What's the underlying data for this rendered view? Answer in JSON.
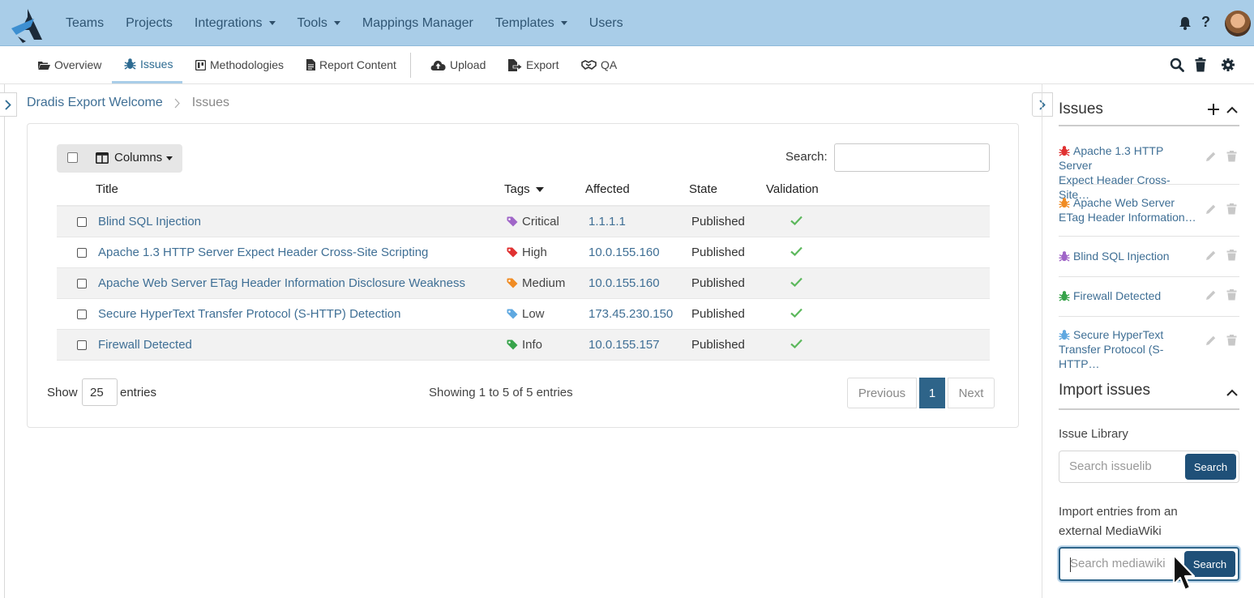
{
  "topnav": {
    "items": [
      {
        "label": "Teams",
        "dropdown": false
      },
      {
        "label": "Projects",
        "dropdown": false
      },
      {
        "label": "Integrations",
        "dropdown": true
      },
      {
        "label": "Tools",
        "dropdown": true
      },
      {
        "label": "Mappings Manager",
        "dropdown": false
      },
      {
        "label": "Templates",
        "dropdown": true
      },
      {
        "label": "Users",
        "dropdown": false
      }
    ],
    "help": "?"
  },
  "subnav": {
    "overview": "Overview",
    "issues": "Issues",
    "methodologies": "Methodologies",
    "report_content": "Report Content",
    "upload": "Upload",
    "export": "Export",
    "qa": "QA"
  },
  "breadcrumb": {
    "project": "Dradis Export Welcome",
    "current": "Issues"
  },
  "table": {
    "columns_button": "Columns",
    "search_label": "Search:",
    "headers": {
      "title": "Title",
      "tags": "Tags",
      "affected": "Affected",
      "state": "State",
      "validation": "Validation"
    },
    "rows": [
      {
        "title": "Blind SQL Injection",
        "tag": "Critical",
        "tag_color": "#a066c8",
        "affected": "1.1.1.1",
        "state": "Published"
      },
      {
        "title": "Apache 1.3 HTTP Server Expect Header Cross-Site Scripting",
        "tag": "High",
        "tag_color": "#e03131",
        "affected": "10.0.155.160",
        "state": "Published"
      },
      {
        "title": "Apache Web Server ETag Header Information Disclosure Weakness",
        "tag": "Medium",
        "tag_color": "#f08c24",
        "affected": "10.0.155.160",
        "state": "Published"
      },
      {
        "title": "Secure HyperText Transfer Protocol (S-HTTP) Detection",
        "tag": "Low",
        "tag_color": "#5fa8e0",
        "affected": "173.45.230.150",
        "state": "Published"
      },
      {
        "title": "Firewall Detected",
        "tag": "Info",
        "tag_color": "#37a34a",
        "affected": "10.0.155.157",
        "state": "Published"
      }
    ],
    "show_label": "Show",
    "page_size": "25",
    "entries_label": "entries",
    "info": "Showing 1 to 5 of 5 entries",
    "prev": "Previous",
    "page": "1",
    "next": "Next"
  },
  "sidebar": {
    "issues_title": "Issues",
    "issues": [
      {
        "line1": "Apache 1.3 HTTP Server",
        "line2": "Expect Header Cross-Site…",
        "color": "#e03131"
      },
      {
        "line1": "Apache Web Server",
        "line2": "ETag Header Information…",
        "color": "#f08c24"
      },
      {
        "line1": "Blind SQL Injection",
        "line2": "",
        "color": "#a066c8"
      },
      {
        "line1": "Firewall Detected",
        "line2": "",
        "color": "#37a34a"
      },
      {
        "line1": "Secure HyperText",
        "line2": "Transfer Protocol (S-HTTP…",
        "color": "#5fa8e0"
      }
    ],
    "import_title": "Import issues",
    "issue_library_label": "Issue Library",
    "issuelib_placeholder": "Search issuelib",
    "search_btn": "Search",
    "mediawiki_label_1": "Import entries from an",
    "mediawiki_label_2": "external MediaWiki",
    "mediawiki_placeholder": "Search mediawiki",
    "search_btn2": "Search"
  },
  "colors": {
    "navbar": "#a9cde8",
    "link": "#3f6f95",
    "primary_button": "#1f5078",
    "validation_check": "#5cb85c"
  }
}
